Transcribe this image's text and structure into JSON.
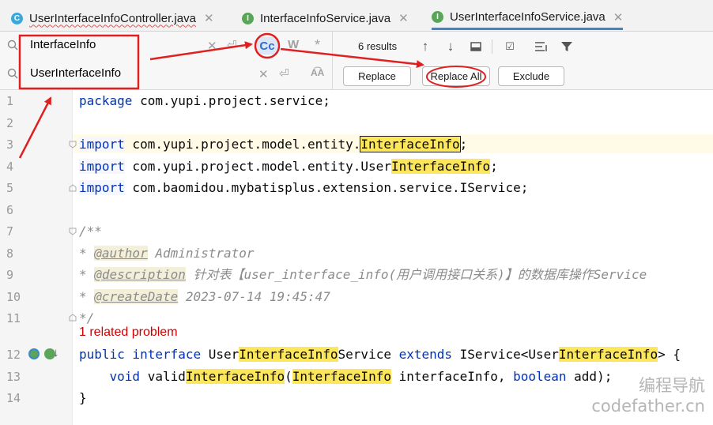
{
  "tabs": [
    {
      "label": "UserInterfaceInfoController.java",
      "icon": "class-icon",
      "active": false
    },
    {
      "label": "InterfaceInfoService.java",
      "icon": "interface-icon",
      "active": false
    },
    {
      "label": "UserInterfaceInfoService.java",
      "icon": "interface-icon",
      "active": true
    }
  ],
  "find": {
    "search_value": "InterfaceInfo",
    "replace_value": "UserInterfaceInfo",
    "match_case_label": "Cc",
    "words_label": "W",
    "regex_label": "*",
    "results": "6 results"
  },
  "buttons": {
    "replace": "Replace",
    "replace_all": "Replace All",
    "exclude": "Exclude"
  },
  "editor": {
    "line_numbers": [
      "1",
      "2",
      "3",
      "4",
      "5",
      "6",
      "7",
      "8",
      "9",
      "10",
      "11",
      "12",
      "13",
      "14"
    ],
    "line1": {
      "kw": "package",
      "rest": " com.yupi.project.service;"
    },
    "line3": {
      "kw": "import",
      "pre": " com.yupi.project.model.entity.",
      "hl": "InterfaceInfo",
      "post": ";"
    },
    "line4": {
      "kw": "import",
      "pre": " com.yupi.project.model.entity.User",
      "hl": "InterfaceInfo",
      "post": ";"
    },
    "line5": {
      "kw": "import",
      "rest": " com.baomidou.mybatisplus.extension.service.IService;"
    },
    "line7": "/**",
    "line8": {
      "star": "* ",
      "tag": "@author",
      "rest": " Administrator"
    },
    "line9": {
      "star": "* ",
      "tag": "@description",
      "rest": " 针对表【user_interface_info(用户调用接口关系)】的数据库操作Service"
    },
    "line10": {
      "star": "* ",
      "tag": "@createDate",
      "rest": " 2023-07-14 19:45:47"
    },
    "line11": "*/",
    "problem": "1 related problem",
    "line12": {
      "kw1": "public",
      "kw2": " interface",
      "t1": " User",
      "hl1": "InterfaceInfo",
      "t2": "Service ",
      "kw3": "extends",
      "t3": " IService<User",
      "hl2": "InterfaceInfo",
      "t4": "> {"
    },
    "line13": {
      "kw": "void",
      "t1": " valid",
      "hl1": "InterfaceInfo",
      "t2": "(",
      "hl2": "InterfaceInfo",
      "t3": " interfaceInfo, ",
      "kw2": "boolean",
      "t4": " add);"
    },
    "line14": "}"
  },
  "watermark": {
    "line1": "编程导航",
    "line2": "codefather.cn"
  },
  "colors": {
    "annotation_red": "#e02020",
    "match_highlight": "#fbe65c",
    "keyword": "#0033b3"
  }
}
